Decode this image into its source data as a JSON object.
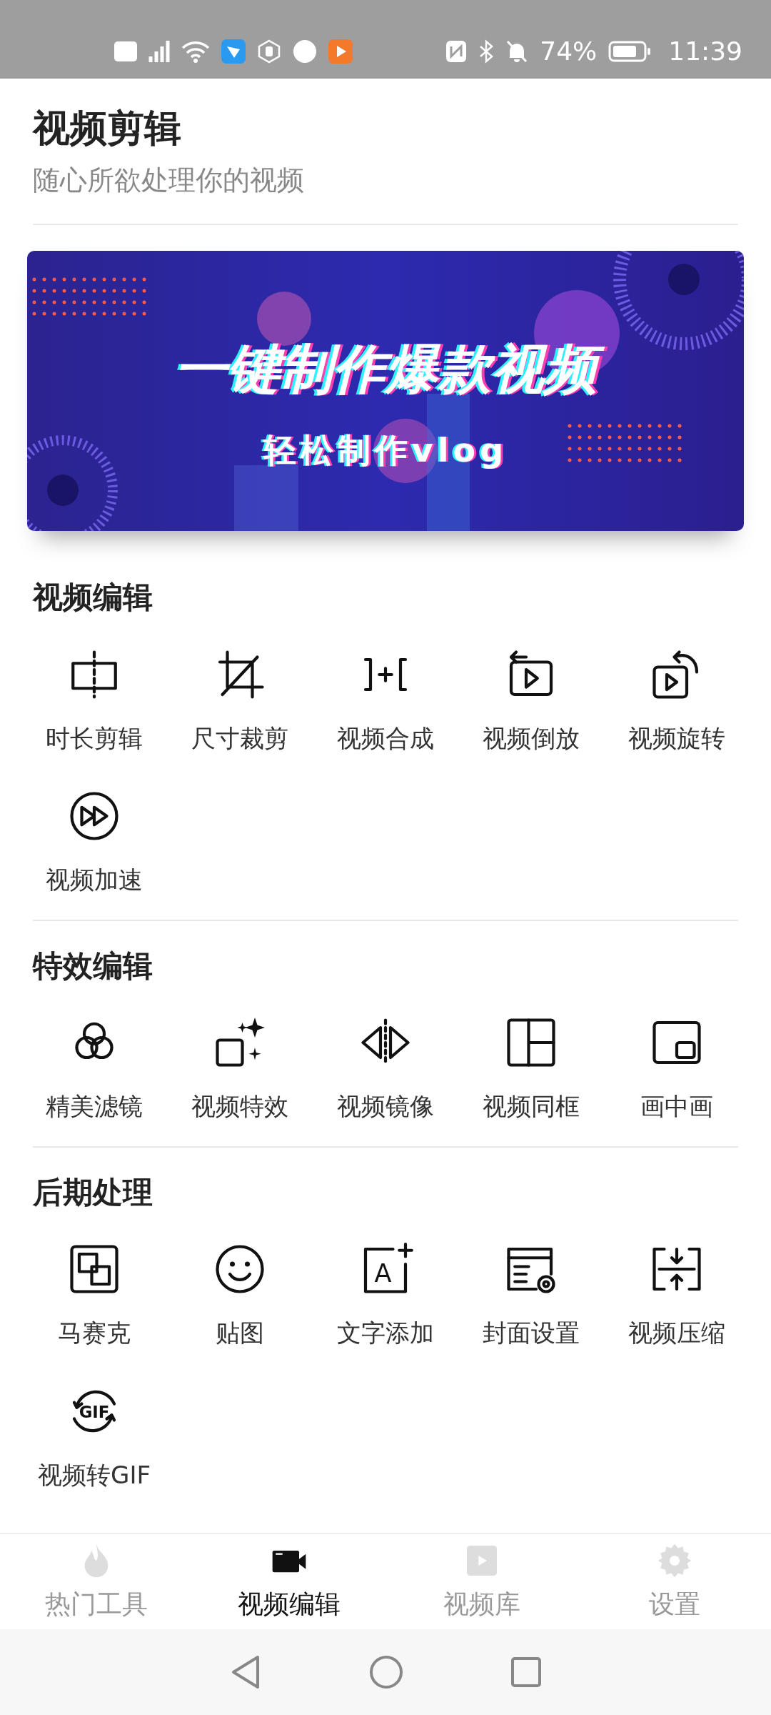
{
  "status_bar": {
    "battery_text": "74%",
    "time": "11:39"
  },
  "header": {
    "title": "视频剪辑",
    "subtitle": "随心所欲处理你的视频"
  },
  "banner": {
    "headline": "一键制作爆款视频",
    "tagline": "轻松制作vlog"
  },
  "sections": [
    {
      "title": "视频编辑",
      "items": [
        {
          "label": "时长剪辑",
          "kind": "trim"
        },
        {
          "label": "尺寸裁剪",
          "kind": "crop"
        },
        {
          "label": "视频合成",
          "kind": "merge"
        },
        {
          "label": "视频倒放",
          "kind": "reverse"
        },
        {
          "label": "视频旋转",
          "kind": "rotate"
        },
        {
          "label": "视频加速",
          "kind": "speed"
        }
      ]
    },
    {
      "title": "特效编辑",
      "items": [
        {
          "label": "精美滤镜",
          "kind": "filter"
        },
        {
          "label": "视频特效",
          "kind": "effects"
        },
        {
          "label": "视频镜像",
          "kind": "mirror"
        },
        {
          "label": "视频同框",
          "kind": "split"
        },
        {
          "label": "画中画",
          "kind": "pip"
        }
      ]
    },
    {
      "title": "后期处理",
      "items": [
        {
          "label": "马赛克",
          "kind": "mosaic"
        },
        {
          "label": "贴图",
          "kind": "sticker"
        },
        {
          "label": "文字添加",
          "kind": "text",
          "icon_text": "A"
        },
        {
          "label": "封面设置",
          "kind": "cover"
        },
        {
          "label": "视频压缩",
          "kind": "compress"
        },
        {
          "label": "视频转GIF",
          "kind": "gif",
          "icon_text": "GIF"
        }
      ]
    }
  ],
  "tabs": [
    {
      "label": "热门工具",
      "kind": "flame",
      "selected": false
    },
    {
      "label": "视频编辑",
      "kind": "camera",
      "selected": true
    },
    {
      "label": "视频库",
      "kind": "library",
      "selected": false
    },
    {
      "label": "设置",
      "kind": "gear",
      "selected": false
    }
  ]
}
